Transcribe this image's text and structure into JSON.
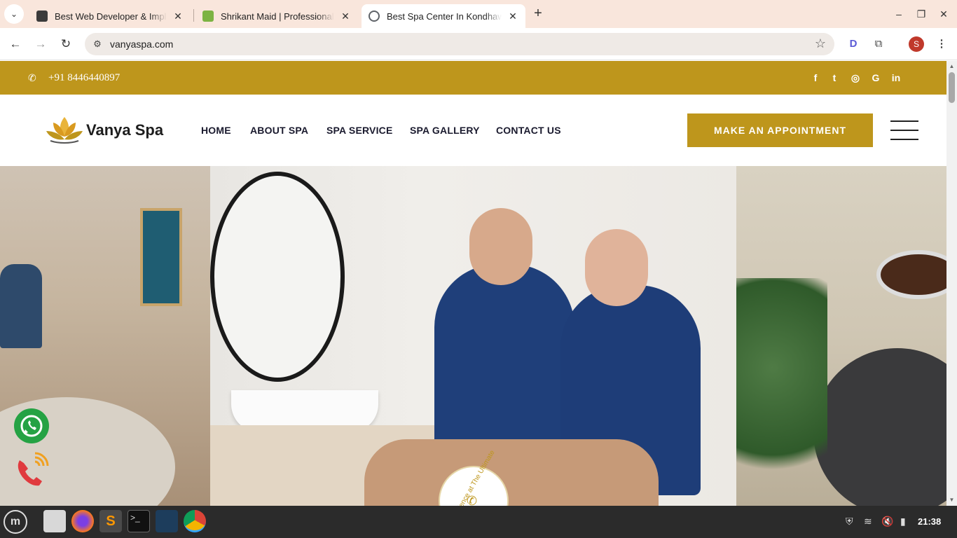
{
  "browser": {
    "tabs": [
      {
        "title": "Best Web Developer & Implementation",
        "favicon_color": "#3b3b3b",
        "active": false
      },
      {
        "title": "Shrikant Maid | Professional",
        "favicon_color": "#7cb342",
        "active": false
      },
      {
        "title": "Best Spa Center In Kondhawa",
        "favicon_color": "#5f6368",
        "active": true
      }
    ],
    "new_tab_label": "+",
    "url": "vanyaspa.com",
    "profile_initial": "S"
  },
  "site": {
    "brand_color": "#be961c",
    "phone": "+91 8446440897",
    "social_icons": [
      "facebook-icon",
      "twitter-icon",
      "instagram-icon",
      "google-icon",
      "linkedin-icon"
    ],
    "social_glyphs": [
      "f",
      "t",
      "◎",
      "G",
      "in"
    ],
    "logo_text": "Vanya Spa",
    "nav": [
      "HOME",
      "ABOUT SPA",
      "SPA SERVICE",
      "SPA GALLERY",
      "CONTACT US"
    ],
    "cta_label": "MAKE AN APPOINTMENT",
    "badge_text": "rience at The Ultimate"
  },
  "taskbar": {
    "clock": "21:38"
  }
}
